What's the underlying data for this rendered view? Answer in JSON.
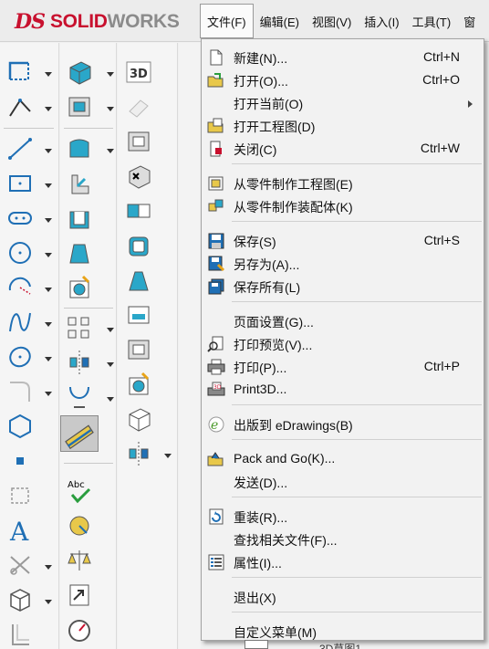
{
  "app": {
    "logo_ds": "DS",
    "logo_solid": "SOLID",
    "logo_works": "WORKS"
  },
  "menubar": [
    "文件(F)",
    "编辑(E)",
    "视图(V)",
    "插入(I)",
    "工具(T)",
    "窗"
  ],
  "file_menu": {
    "groups": [
      [
        {
          "label": "新建(N)...",
          "shortcut": "Ctrl+N",
          "icon": "new-file-icon"
        },
        {
          "label": "打开(O)...",
          "shortcut": "Ctrl+O",
          "icon": "open-folder-icon"
        },
        {
          "label": "打开当前(O)",
          "shortcut": "",
          "icon": "",
          "submenu": true
        },
        {
          "label": "打开工程图(D)",
          "shortcut": "",
          "icon": "open-drawing-icon"
        },
        {
          "label": "关闭(C)",
          "shortcut": "Ctrl+W",
          "icon": "close-document-icon"
        }
      ],
      [
        {
          "label": "从零件制作工程图(E)",
          "shortcut": "",
          "icon": "make-drawing-icon"
        },
        {
          "label": "从零件制作装配体(K)",
          "shortcut": "",
          "icon": "make-assembly-icon"
        }
      ],
      [
        {
          "label": "保存(S)",
          "shortcut": "Ctrl+S",
          "icon": "save-icon"
        },
        {
          "label": "另存为(A)...",
          "shortcut": "",
          "icon": "save-as-icon"
        },
        {
          "label": "保存所有(L)",
          "shortcut": "",
          "icon": "save-all-icon"
        }
      ],
      [
        {
          "label": "页面设置(G)...",
          "shortcut": "",
          "icon": ""
        },
        {
          "label": "打印预览(V)...",
          "shortcut": "",
          "icon": "print-preview-icon"
        },
        {
          "label": "打印(P)...",
          "shortcut": "Ctrl+P",
          "icon": "printer-icon"
        },
        {
          "label": "Print3D...",
          "shortcut": "",
          "icon": "print3d-icon"
        }
      ],
      [
        {
          "label": "出版到 eDrawings(B)",
          "shortcut": "",
          "icon": "edrawings-icon"
        }
      ],
      [
        {
          "label": "Pack and Go(K)...",
          "shortcut": "",
          "icon": "pack-and-go-icon"
        },
        {
          "label": "发送(D)...",
          "shortcut": "",
          "icon": ""
        }
      ],
      [
        {
          "label": "重装(R)...",
          "shortcut": "",
          "icon": "reload-icon"
        },
        {
          "label": "查找相关文件(F)...",
          "shortcut": "",
          "icon": ""
        },
        {
          "label": "属性(I)...",
          "shortcut": "",
          "icon": "properties-icon"
        }
      ],
      [
        {
          "label": "退出(X)",
          "shortcut": "",
          "icon": ""
        }
      ],
      [
        {
          "label": "自定义菜单(M)",
          "shortcut": "",
          "icon": ""
        }
      ]
    ]
  },
  "bottom": {
    "tree_item": "3D草图1"
  },
  "colors": {
    "brand_red": "#c8102e",
    "icon_blue": "#1f6fb5",
    "icon_cyan": "#2aa7c9"
  }
}
